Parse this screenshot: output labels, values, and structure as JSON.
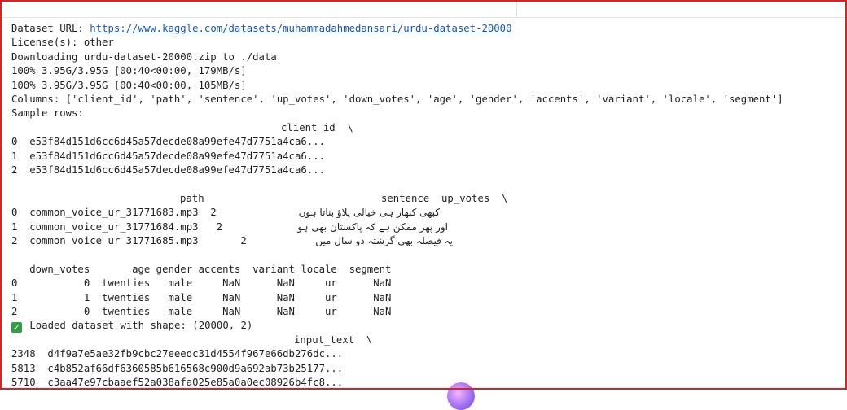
{
  "cell_output": {
    "dataset_url_label": "Dataset URL: ",
    "dataset_url": "https://www.kaggle.com/datasets/muhammadahmedansari/urdu-dataset-20000",
    "license": "License(s): other",
    "downloading": "Downloading urdu-dataset-20000.zip to ./data",
    "progress_1": "100% 3.95G/3.95G [00:40<00:00, 179MB/s]",
    "progress_2": "100% 3.95G/3.95G [00:40<00:00, 105MB/s]",
    "columns": "Columns: ['client_id', 'path', 'sentence', 'up_votes', 'down_votes', 'age', 'gender', 'accents', 'variant', 'locale', 'segment']",
    "sample_rows": "Sample rows:",
    "client_table": {
      "header": "client_id  \\",
      "rows": [
        "0  e53f84d151d6cc6d45a57decde08a99efe47d7751a4ca6...",
        "1  e53f84d151d6cc6d45a57decde08a99efe47d7751a4ca6...",
        "2  e53f84d151d6cc6d45a57decde08a99efe47d7751a4ca6..."
      ]
    },
    "path_table": {
      "header_path": "path",
      "header_rest": "sentence  up_votes  \\",
      "rows": [
        {
          "path": "0  common_voice_ur_31771683.mp3  2",
          "sentence": "کبھی کبھار ہی خیالی پلاؤ بناتا ہوں"
        },
        {
          "path": "1  common_voice_ur_31771684.mp3   2",
          "sentence": "اور پھر ممکن ہے کہ پاکستان بھی ہو"
        },
        {
          "path": "2  common_voice_ur_31771685.mp3       2",
          "sentence": "یہ فیصلہ بھی گزشتہ دو سال میں"
        }
      ]
    },
    "votes_table": {
      "header": "   down_votes       age gender accents  variant locale  segment",
      "rows": [
        "0           0  twenties   male     NaN      NaN     ur      NaN",
        "1           1  twenties   male     NaN      NaN     ur      NaN",
        "2           0  twenties   male     NaN      NaN     ur      NaN"
      ]
    },
    "loaded": "Loaded dataset with shape: (20000, 2)",
    "input_table": {
      "header": "input_text  \\",
      "rows": [
        "2348  d4f9a7e5ae32fb9cbc27eeedc31d4554f967e66db276dc...",
        "5813  c4b852af66df6360585b616568c900d9a692ab73b25177...",
        "5710  c3aa47e97cbaaef52a038afa025e85a0a0ec08926b4fc8..."
      ]
    }
  },
  "icons": {
    "success": "check-icon"
  },
  "colors": {
    "link": "#1a56b8",
    "success": "#2ea043",
    "frame": "#e02020"
  }
}
